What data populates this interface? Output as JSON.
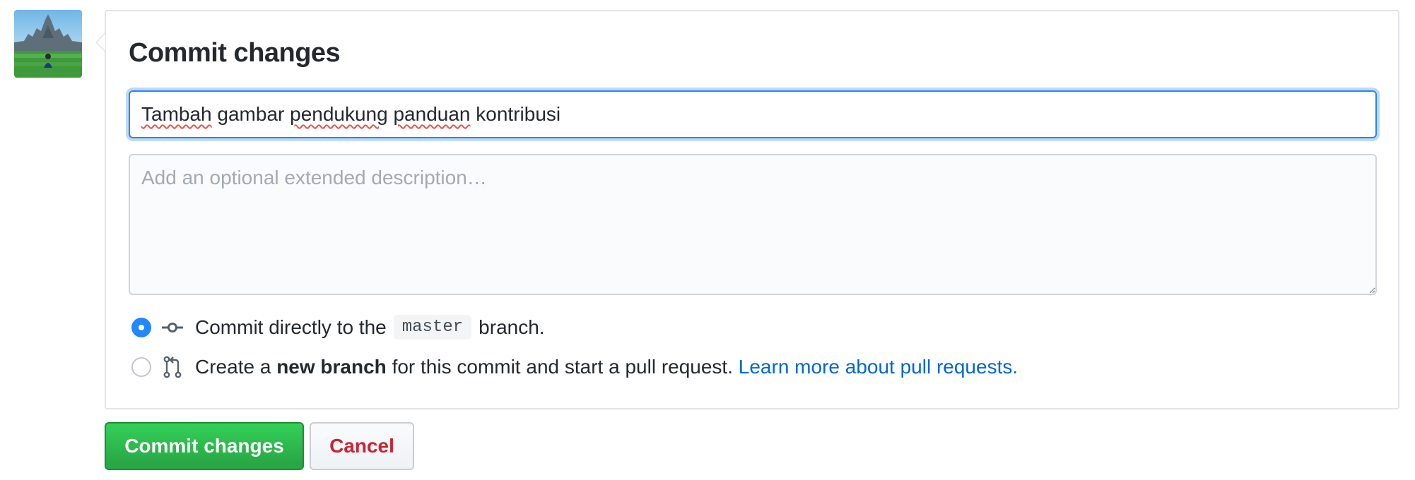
{
  "user": {
    "avatar_icon": "user-avatar-photo"
  },
  "commit_form": {
    "title": "Commit changes",
    "summary_input": {
      "words": [
        "Tambah",
        "gambar",
        "pendukung",
        "panduan",
        "kontribusi"
      ],
      "value": "Tambah gambar pendukung panduan kontribusi"
    },
    "description_input": {
      "value": "",
      "placeholder": "Add an optional extended description…"
    },
    "options": [
      {
        "checked": true,
        "icon": "git-commit-icon",
        "text_before": "Commit directly to the",
        "branch": "master",
        "text_after": "branch."
      },
      {
        "checked": false,
        "icon": "git-pull-request-icon",
        "text_before": "Create a",
        "bold": "new branch",
        "text_after": "for this commit and start a pull request.",
        "link": "Learn more about pull requests."
      }
    ]
  },
  "buttons": {
    "commit": "Commit changes",
    "cancel": "Cancel"
  },
  "colors": {
    "accent_blue": "#2188ff",
    "link_blue": "#0366d6",
    "commit_green": "#28a745",
    "cancel_red": "#cb2431"
  }
}
